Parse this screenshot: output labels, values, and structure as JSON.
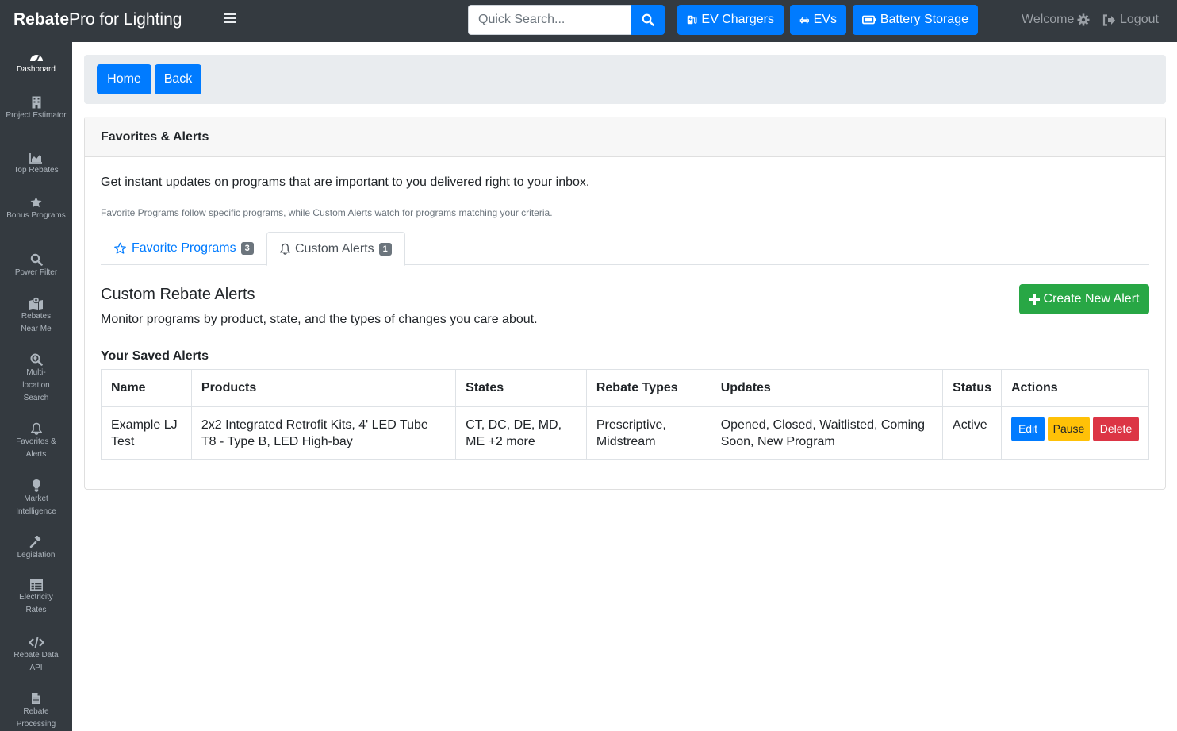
{
  "brand": {
    "bold": "Rebate",
    "rest": "Pro for Lighting"
  },
  "search": {
    "placeholder": "Quick Search..."
  },
  "nav": {
    "ev_chargers": "EV Chargers",
    "evs": "EVs",
    "battery_storage": "Battery Storage",
    "welcome": "Welcome",
    "logout": "Logout"
  },
  "sidebar": {
    "items": [
      {
        "label": "Dashboard",
        "icon": "dashboard-icon"
      },
      {
        "label": "Project Estimator",
        "icon": "building-icon"
      },
      {
        "label": "Top Rebates",
        "icon": "chart-icon"
      },
      {
        "label": "Bonus Programs",
        "icon": "star-icon"
      },
      {
        "label": "Power Filter",
        "icon": "search-icon"
      },
      {
        "label": "Rebates Near Me",
        "icon": "map-icon"
      },
      {
        "label": "Multi-location Search",
        "icon": "search-plus-icon"
      },
      {
        "label": "Favorites & Alerts",
        "icon": "bell-icon"
      },
      {
        "label": "Market Intelligence",
        "icon": "lightbulb-icon"
      },
      {
        "label": "Legislation",
        "icon": "gavel-icon"
      },
      {
        "label": "Electricity Rates",
        "icon": "table-icon"
      },
      {
        "label": "Rebate Data API",
        "icon": "code-icon"
      },
      {
        "label": "Rebate Processing",
        "icon": "file-icon"
      }
    ]
  },
  "breadcrumb": {
    "home": "Home",
    "back": "Back"
  },
  "card": {
    "title": "Favorites & Alerts",
    "intro": "Get instant updates on programs that are important to you delivered right to your inbox.",
    "intro_small": "Favorite Programs follow specific programs, while Custom Alerts watch for programs matching your criteria."
  },
  "tabs": [
    {
      "label": "Favorite Programs",
      "count": "3"
    },
    {
      "label": "Custom Alerts",
      "count": "1"
    }
  ],
  "section": {
    "title": "Custom Rebate Alerts",
    "subtitle": "Monitor programs by product, state, and the types of changes you care about.",
    "create_button": "Create New Alert",
    "saved_title": "Your Saved Alerts"
  },
  "table": {
    "headers": [
      "Name",
      "Products",
      "States",
      "Rebate Types",
      "Updates",
      "Status",
      "Actions"
    ],
    "rows": [
      {
        "name": "Example LJ Test",
        "products": "2x2 Integrated Retrofit Kits, 4' LED Tube T8 - Type B, LED High-bay",
        "states": "CT, DC, DE, MD, ME +2 more",
        "rebate_types": "Prescriptive, Midstream",
        "updates": "Opened, Closed, Waitlisted, Coming Soon, New Program",
        "status": "Active",
        "actions": {
          "edit": "Edit",
          "pause": "Pause",
          "delete": "Delete"
        }
      }
    ]
  },
  "colors": {
    "primary": "#007bff",
    "success": "#28a745",
    "warning": "#ffc107",
    "danger": "#dc3545",
    "dark": "#343a40"
  }
}
